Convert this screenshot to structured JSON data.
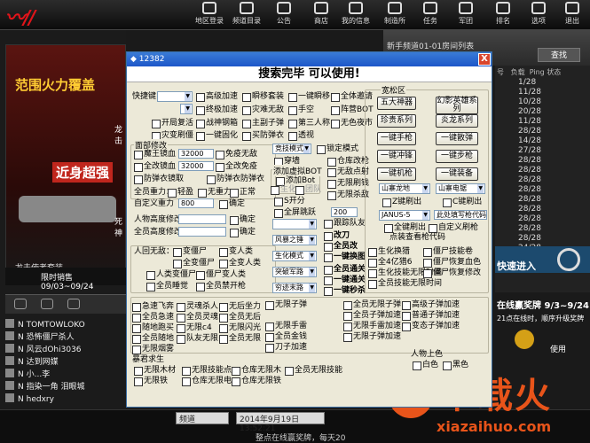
{
  "nav": {
    "items": [
      "地区登录",
      "频道目录",
      "公告",
      "商店",
      "我的信息",
      "制造所",
      "任务",
      "军团",
      "排名",
      "选项",
      "退出"
    ]
  },
  "left": {
    "promo_title": "范围火力覆盖",
    "promo_sub": "近身超强",
    "promo_caption": "龙击使者套装",
    "side_text": "龙击",
    "side_text2": "死神",
    "sale": "限时销售 09/03~09/24",
    "players": [
      "TOMTOWLOKO",
      "恐怖僵尸杀人",
      "风云dOhi3036",
      "达到网媒",
      "小...李",
      "指染一角 泪眼城",
      "hedxry"
    ],
    "player_prefix": [
      "N",
      "N",
      "N",
      "N",
      "N",
      "N",
      "N"
    ]
  },
  "right": {
    "search_btn": "查找",
    "headers": [
      "号",
      "负载",
      "Ping",
      "状态"
    ],
    "rows": [
      "1/28",
      "11/28",
      "10/28",
      "20/28",
      "11/28",
      "28/28",
      "14/28",
      "27/28",
      "28/28",
      "28/28",
      "28/28",
      "28/28",
      "28/28",
      "28/28",
      "28/28",
      "28/28",
      "28/28",
      "24/28",
      "28/28"
    ],
    "join": "快速进入",
    "event_title": "在线赢奖牌 9/3~9/24",
    "event_sub": "21点在线时，顺序升级奖牌",
    "event_use": "使用"
  },
  "top_channel": "新手频道01-01房间列表",
  "bottom": {
    "channel": "频道",
    "datetime": "2014年9月19日13:52:21",
    "notice": "整点在线赢奖牌，每天20"
  },
  "watermark": {
    "cn": "下载火",
    "url": "xiazaihuo.com"
  },
  "dialog": {
    "title": "12382",
    "heading": "搜索完毕 可以使用!",
    "close": "X",
    "col1": {
      "quick_key": "快捷键",
      "r1": [
        "高级加速",
        "瞬移套装",
        "一键瞬移",
        "全体邀请"
      ],
      "r2": [
        "终极加速",
        "灾难无敌",
        "手空",
        "阵营BOT"
      ],
      "r3": [
        "开局复活",
        "战神钢箱",
        "主副子弹",
        "第三人称",
        "无色夜市"
      ],
      "r4": [
        "灾变刷僵",
        "一键固化",
        "买防弹衣",
        "透视"
      ],
      "mode_label": "面部修改",
      "god1": "魔王镜血",
      "god1_val": "32000",
      "god1_opt": "免疫无敌",
      "god2": "全改镜血",
      "god2_val": "32000",
      "god2_opt": "全改免疫",
      "god3": "防弹衣镜取",
      "god3_opt": "防弹衣防弹衣",
      "gravity_label": "全员重力：",
      "gravity_opts": [
        "轻盈",
        "无重力",
        "正常"
      ],
      "cust_gravity": "自定义重力",
      "cust_val": "800",
      "cust_ok": "确定",
      "height1": "人物高度修改",
      "height1_ok": "确定",
      "height2": "全员高度修改",
      "height2_ok": "确定",
      "human_label": "人回无敌：",
      "human_opts": [
        "变僵尸",
        "变人类",
        "全变僵尸",
        "全变人类",
        "人类变僵尸",
        "僵尸变人类",
        "全员睡觉",
        "全员禁开枪"
      ]
    },
    "col2": {
      "mode_sel": "竞技模式",
      "mode_lock": "锁定模式",
      "wallhack": "穿墙",
      "storage": "仓库改枪",
      "bot_label": "添加虚拟BOT",
      "bot1": "添加Bot",
      "bot_opts": [
        "生化",
        "团队"
      ],
      "hit": "无敌点射",
      "zhongjin": "无限刷钱",
      "rapid": "无限杀敌",
      "zoom": "全屏跳跃",
      "zoom_val": "200",
      "sfx": "S开分",
      "fast_team": "跟踪队友",
      "weapon_sel": "风暴之锤",
      "gai": "改刀",
      "huan": "全员改",
      "knife": "一键换图",
      "mode2": "生化模式",
      "boss": "全员通关",
      "cap": "一键通关",
      "fly": "突破军路",
      "kill": "一键秒杀",
      "jump": "穷迹末路"
    },
    "col3": {
      "area_label": "宽松区",
      "b1": "五大神器",
      "b2": "幻影英雄系列",
      "b3": "珍贵系列",
      "b4": "炎龙系列",
      "b5": "一键手枪",
      "b6": "一键散弹",
      "b7": "一键冲锋",
      "b8": "一键步枪",
      "b9": "一键机枪",
      "b10": "一键装备",
      "map1": "山寨龙地",
      "map2": "山寨电锯",
      "z1": "Z键刷出",
      "c1": "C键刷出",
      "box_sel": "JANUS-5",
      "b_code": "此处填写枪代码",
      "r1": "全键刷出",
      "r2": "自定义刷枪",
      "cheat": "点装查看枪代码"
    },
    "lower": {
      "s1": [
        "急速飞奔",
        "全员急速",
        "随地跑买",
        "全员随地",
        "无限烟雾"
      ],
      "s2": [
        "灵魂杀人",
        "全员灵魂",
        "无限c4",
        "队友无限"
      ],
      "s3": [
        "无后坐力",
        "全员无后",
        "无限闪光",
        "全员无限"
      ],
      "s4": [
        "无限子弹",
        "无限手雷",
        "全员金钱",
        "刀子加速"
      ],
      "s5": [
        "全员无限子弹",
        "全员子弹加速",
        "无限手雷加速",
        "无限子弹加速"
      ],
      "s6": [
        "高级子弹加速",
        "普通子弹加速",
        "变态子弹加速"
      ],
      "role_label": "人物上色",
      "role1": "白色",
      "role2": "黑色",
      "dim1": "生化换猎",
      "dim2": "全4亿猎6",
      "dim3": "生化技能无限时间",
      "dim4": "全员技能无限时间",
      "d1": "僵尸技能卷",
      "d2": "僵尸恢复血色",
      "d3": "僵尸恢复修改",
      "box_label": "暴君求生",
      "box1": "无限木材",
      "box2": "无限技能点",
      "box3": "仓库无限木",
      "box4": "全员无限技能",
      "box5": "无限铁",
      "box6": "仓库无限电",
      "box7": "仓库无限铁"
    }
  }
}
